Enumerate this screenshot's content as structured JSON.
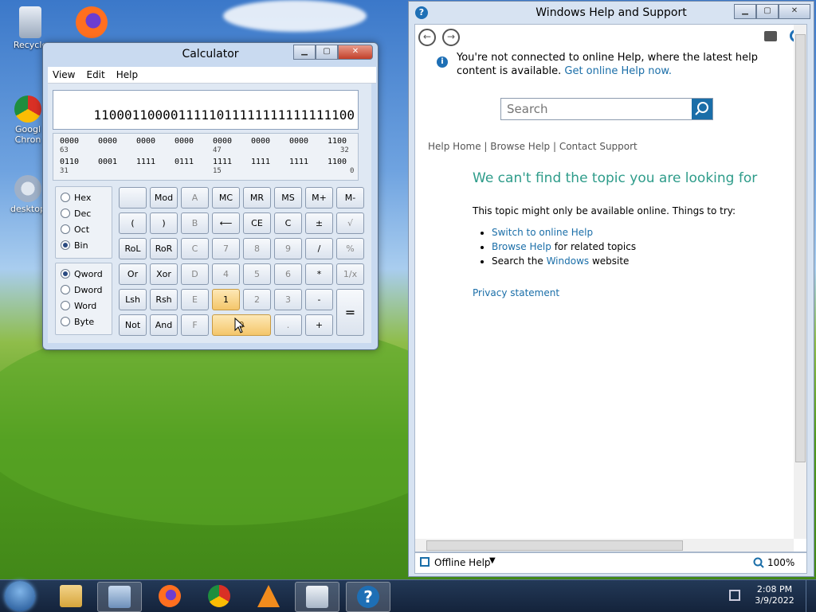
{
  "desktop": {
    "icons": [
      {
        "label": "Recycle"
      },
      {
        "label": "Googl\nChron"
      },
      {
        "label": "desktop"
      }
    ]
  },
  "calculator": {
    "title": "Calculator",
    "menu": [
      "View",
      "Edit",
      "Help"
    ],
    "display": "1100011000011111011111111111111100",
    "bits": {
      "row1": [
        "0000",
        "0000",
        "0000",
        "0000",
        "0000",
        "0000",
        "0000",
        "1100"
      ],
      "row1_nums": [
        "63",
        "47",
        "32"
      ],
      "row2": [
        "0110",
        "0001",
        "1111",
        "0111",
        "1111",
        "1111",
        "1111",
        "1100"
      ],
      "row2_nums": [
        "31",
        "15",
        "0"
      ]
    },
    "base_modes": [
      {
        "label": "Hex",
        "selected": false
      },
      {
        "label": "Dec",
        "selected": false
      },
      {
        "label": "Oct",
        "selected": false
      },
      {
        "label": "Bin",
        "selected": true
      }
    ],
    "word_modes": [
      {
        "label": "Qword",
        "selected": true
      },
      {
        "label": "Dword",
        "selected": false
      },
      {
        "label": "Word",
        "selected": false
      },
      {
        "label": "Byte",
        "selected": false
      }
    ],
    "keys": {
      "row1": [
        "",
        "Mod",
        "A",
        "MC",
        "MR",
        "MS",
        "M+",
        "M-"
      ],
      "row2": [
        "(",
        ")",
        "B",
        "⟵",
        "CE",
        "C",
        "±",
        "√"
      ],
      "row3": [
        "RoL",
        "RoR",
        "C",
        "7",
        "8",
        "9",
        "/",
        "%"
      ],
      "row4": [
        "Or",
        "Xor",
        "D",
        "4",
        "5",
        "6",
        "*",
        "1/x"
      ],
      "row5": [
        "Lsh",
        "Rsh",
        "E",
        "1",
        "2",
        "3",
        "-",
        "="
      ],
      "row6": [
        "Not",
        "And",
        "F",
        "0",
        ".",
        "+"
      ]
    }
  },
  "help": {
    "title": "Windows Help and Support",
    "notice": "You're not connected to online Help, where the latest help content is available.",
    "notice_link": "Get online Help now.",
    "search_placeholder": "Search",
    "nav": "Help Home | Browse Help | Contact Support",
    "heading": "We can't find the topic you are looking for",
    "intro": "This topic might only be available online. Things to try:",
    "items": [
      {
        "link": "Switch to online Help",
        "rest": ""
      },
      {
        "link": "Browse Help",
        "rest": " for related topics"
      },
      {
        "pre": "Search the ",
        "link": "Windows",
        "rest": " website"
      }
    ],
    "privacy": "Privacy statement",
    "footer_left": "Offline Help",
    "zoom": "100%"
  },
  "taskbar": {
    "time": "2:08 PM",
    "date": "3/9/2022"
  }
}
